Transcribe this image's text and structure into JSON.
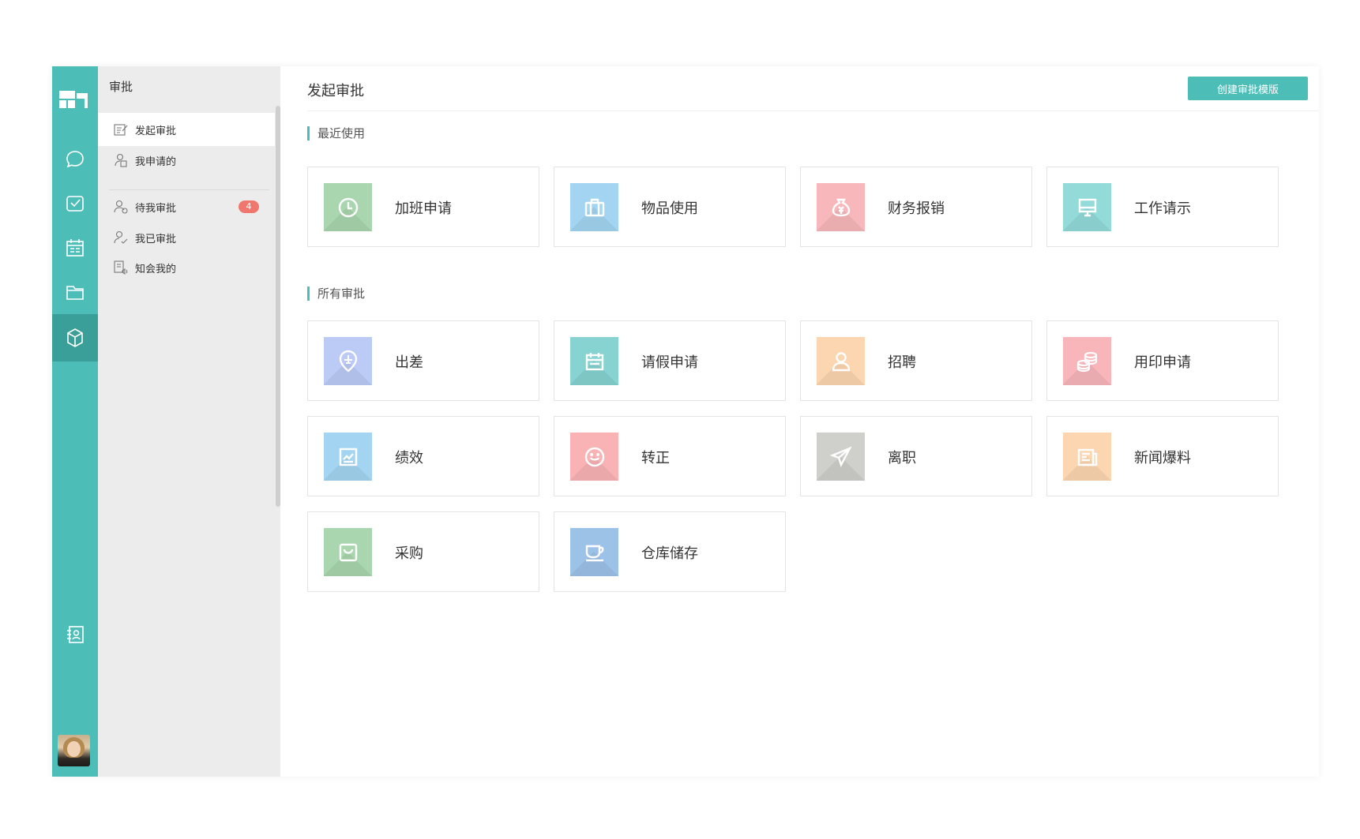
{
  "sidebar": {
    "title": "审批",
    "items": [
      {
        "label": "发起审批"
      },
      {
        "label": "我申请的"
      },
      {
        "label": "待我审批",
        "badge": "4"
      },
      {
        "label": "我已审批"
      },
      {
        "label": "知会我的"
      }
    ]
  },
  "main": {
    "title": "发起审批",
    "create_button": "创建审批模版",
    "recent_label": "最近使用",
    "all_label": "所有审批",
    "recent": [
      {
        "label": "加班申请",
        "icon": "clock-icon",
        "color": "#a9d6ae"
      },
      {
        "label": "物品使用",
        "icon": "briefcase-icon",
        "color": "#a3d5f2"
      },
      {
        "label": "财务报销",
        "icon": "money-bag-icon",
        "color": "#f8b8bb"
      },
      {
        "label": "工作请示",
        "icon": "monitor-icon",
        "color": "#92dbd9"
      }
    ],
    "all": [
      {
        "label": "出差",
        "icon": "plane-pin-icon",
        "color": "#bccbf6"
      },
      {
        "label": "请假申请",
        "icon": "calendar-icon",
        "color": "#86d3d1"
      },
      {
        "label": "招聘",
        "icon": "person-icon",
        "color": "#fcd6b0"
      },
      {
        "label": "用印申请",
        "icon": "coins-icon",
        "color": "#f8b6ba"
      },
      {
        "label": "绩效",
        "icon": "chart-icon",
        "color": "#a3d5f2"
      },
      {
        "label": "转正",
        "icon": "smile-icon",
        "color": "#f9b3b5"
      },
      {
        "label": "离职",
        "icon": "paper-plane-icon",
        "color": "#cfcfcb"
      },
      {
        "label": "新闻爆料",
        "icon": "newspaper-icon",
        "color": "#fcd6b0"
      },
      {
        "label": "采购",
        "icon": "shopping-bag-icon",
        "color": "#a9d6ae"
      },
      {
        "label": "仓库储存",
        "icon": "cup-icon",
        "color": "#9dc2e8"
      }
    ]
  },
  "colors": {
    "accent": "#4dbdb7",
    "rail_active": "#3a9e99",
    "badge": "#f0776e"
  }
}
